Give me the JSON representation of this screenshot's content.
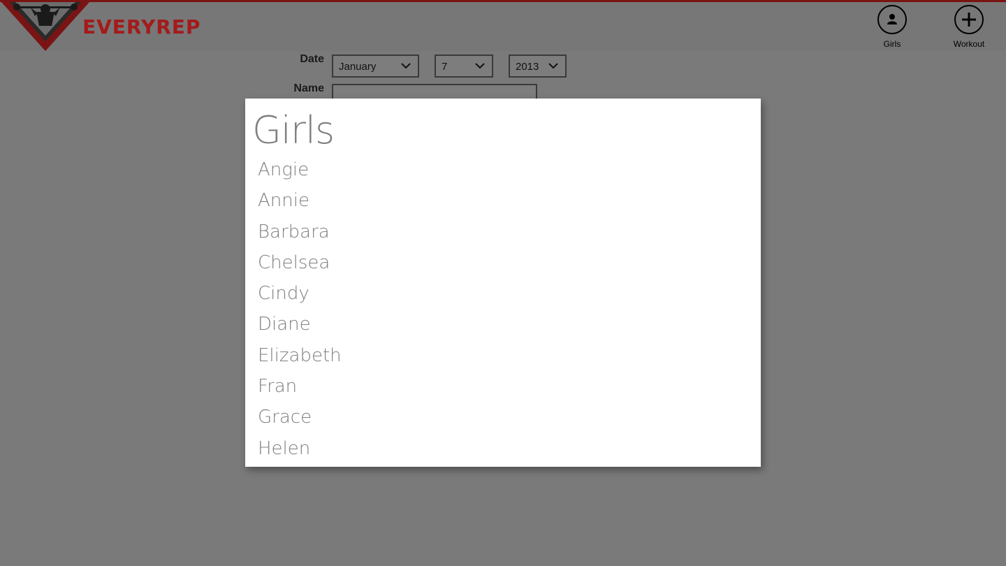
{
  "app": {
    "brand": "EVERYREP"
  },
  "appbar": {
    "girls_label": "Girls",
    "workout_label": "Workout"
  },
  "form": {
    "date_label": "Date",
    "name_label": "Name",
    "month": "January",
    "day": "7",
    "year": "2013",
    "name_value": ""
  },
  "dialog": {
    "title": "Girls",
    "items": [
      "Angie",
      "Annie",
      "Barbara",
      "Chelsea",
      "Cindy",
      "Diane",
      "Elizabeth",
      "Fran",
      "Grace",
      "Helen"
    ]
  },
  "colors": {
    "brand_red": "#a31b1b",
    "overlay_gray": "#7a7a7a",
    "dialog_bg": "#ffffff",
    "list_text": "#7f7f7f"
  }
}
